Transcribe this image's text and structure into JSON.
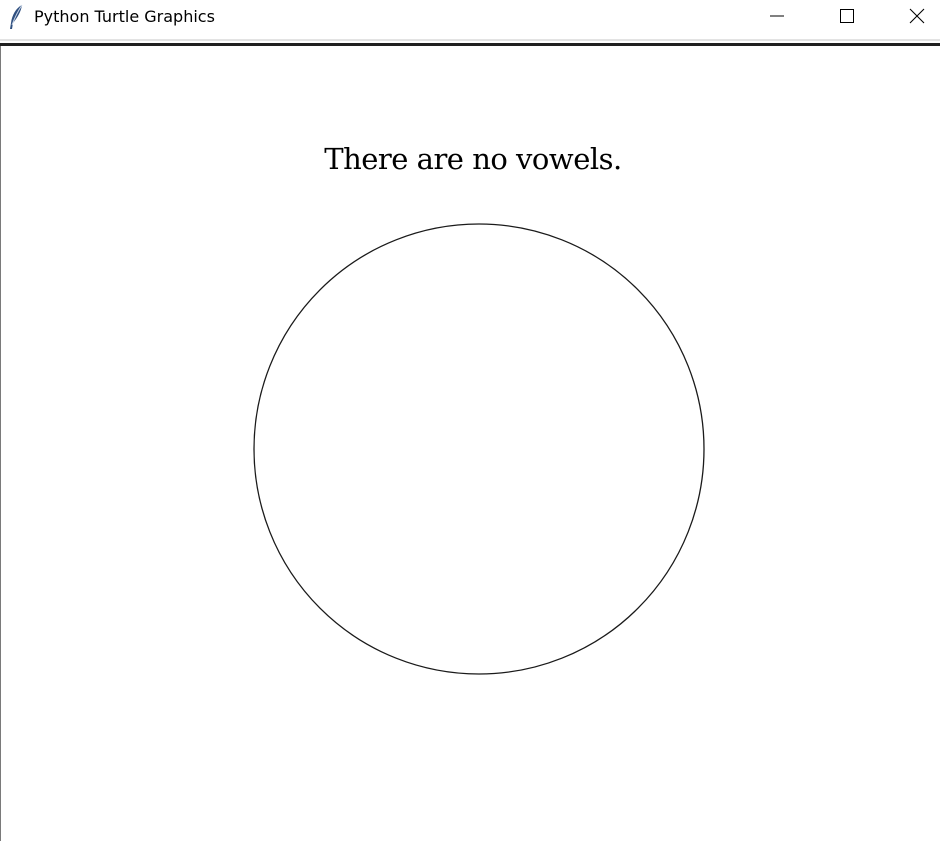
{
  "window": {
    "title": "Python Turtle Graphics",
    "icon": "feather-icon"
  },
  "controls": {
    "minimize_icon": "minimize-icon",
    "maximize_icon": "maximize-icon",
    "close_icon": "close-icon"
  },
  "canvas": {
    "message": "There are no vowels.",
    "shape": "circle",
    "stroke_color": "#1a1a1a",
    "background": "#ffffff"
  }
}
